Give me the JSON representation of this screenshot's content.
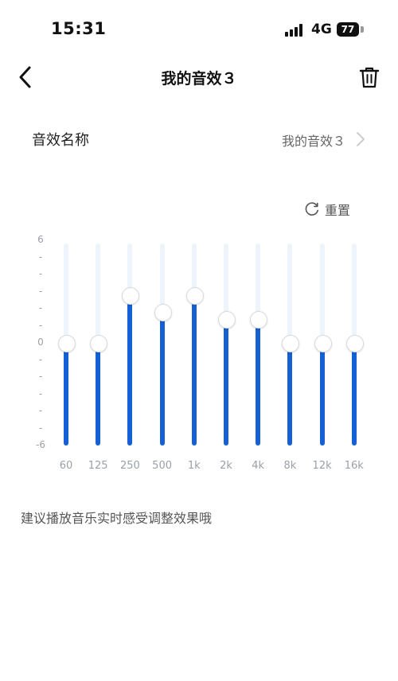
{
  "status": {
    "time": "15:31",
    "network": "4G",
    "battery": "77"
  },
  "nav": {
    "title": "我的音效３",
    "back_icon": "chevron-left-icon",
    "delete_icon": "trash-icon"
  },
  "name_row": {
    "label": "音效名称",
    "value": "我的音效３"
  },
  "reset": {
    "label": "重置",
    "icon": "refresh-icon"
  },
  "equalizer": {
    "axis_labels": [
      "6",
      "-",
      "-",
      "-",
      "-",
      "-",
      "0",
      "-",
      "-",
      "-",
      "-",
      "-",
      "-6"
    ],
    "range": [
      -6,
      6
    ],
    "bands": [
      {
        "label": "60",
        "gain": 0
      },
      {
        "label": "125",
        "gain": 0
      },
      {
        "label": "250",
        "gain": 2.8
      },
      {
        "label": "500",
        "gain": 1.8
      },
      {
        "label": "1k",
        "gain": 2.8
      },
      {
        "label": "2k",
        "gain": 1.4
      },
      {
        "label": "4k",
        "gain": 1.4
      },
      {
        "label": "8k",
        "gain": 0
      },
      {
        "label": "12k",
        "gain": 0
      },
      {
        "label": "16k",
        "gain": 0
      }
    ],
    "colors": {
      "fill": "#1560d4",
      "track": "#eef4fb"
    }
  },
  "hint": "建议播放音乐实时感受调整效果哦"
}
